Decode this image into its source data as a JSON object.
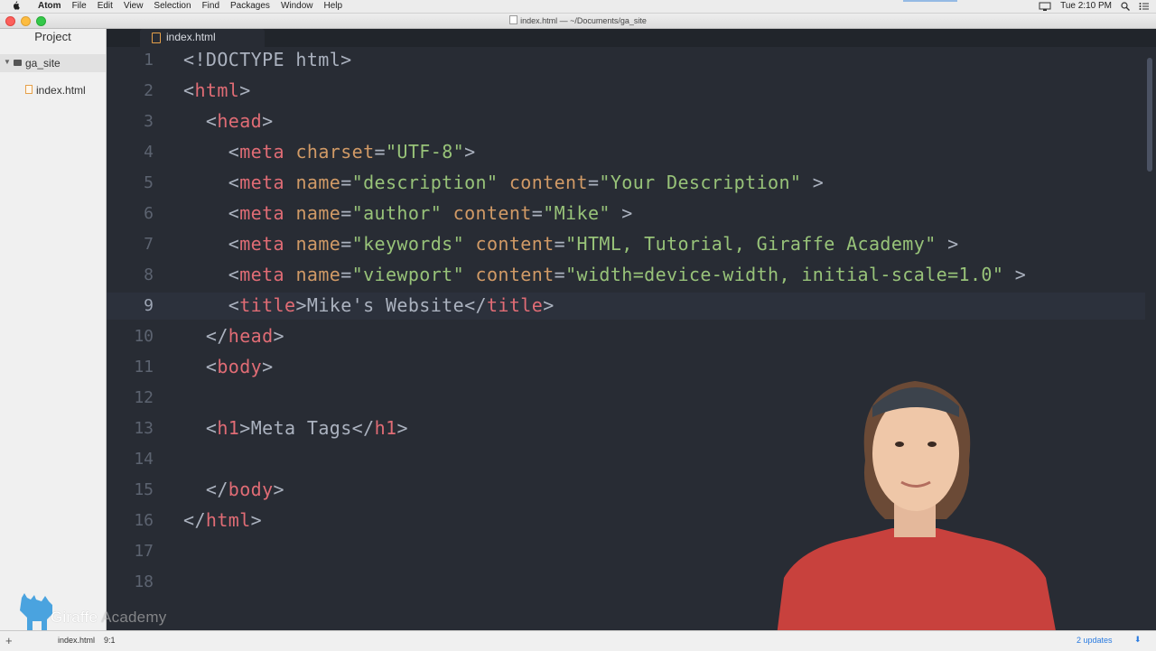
{
  "menubar": {
    "app": "Atom",
    "items": [
      "File",
      "Edit",
      "View",
      "Selection",
      "Find",
      "Packages",
      "Window",
      "Help"
    ],
    "clock": "Tue 2:10 PM"
  },
  "window": {
    "title": "index.html — ~/Documents/ga_site"
  },
  "sidebar": {
    "header": "Project",
    "folder": "ga_site",
    "file": "index.html"
  },
  "tab": {
    "label": "index.html"
  },
  "editor": {
    "lines": [
      {
        "num": "1",
        "active": false
      },
      {
        "num": "2",
        "active": false
      },
      {
        "num": "3",
        "active": false
      },
      {
        "num": "4",
        "active": false
      },
      {
        "num": "5",
        "active": false
      },
      {
        "num": "6",
        "active": false
      },
      {
        "num": "7",
        "active": false
      },
      {
        "num": "8",
        "active": false
      },
      {
        "num": "9",
        "active": true
      },
      {
        "num": "10",
        "active": false
      },
      {
        "num": "11",
        "active": false
      },
      {
        "num": "12",
        "active": false
      },
      {
        "num": "13",
        "active": false
      },
      {
        "num": "14",
        "active": false
      },
      {
        "num": "15",
        "active": false
      },
      {
        "num": "16",
        "active": false
      },
      {
        "num": "17",
        "active": false
      },
      {
        "num": "18",
        "active": false
      }
    ],
    "code": {
      "l1": "<!DOCTYPE html>",
      "l2_tag": "html",
      "l3_tag": "head",
      "l4": {
        "tag": "meta",
        "attr1": "charset",
        "val1": "\"UTF-8\""
      },
      "l5": {
        "tag": "meta",
        "attr1": "name",
        "val1": "\"description\"",
        "attr2": "content",
        "val2": "\"Your Description\""
      },
      "l6": {
        "tag": "meta",
        "attr1": "name",
        "val1": "\"author\"",
        "attr2": "content",
        "val2": "\"Mike\""
      },
      "l7": {
        "tag": "meta",
        "attr1": "name",
        "val1": "\"keywords\"",
        "attr2": "content",
        "val2": "\"HTML, Tutorial, Giraffe Academy\""
      },
      "l8": {
        "tag": "meta",
        "attr1": "name",
        "val1": "\"viewport\"",
        "attr2": "content",
        "val2": "\"width=device-width, initial-scale=1.0\""
      },
      "l9": {
        "tag": "title",
        "text": "Mike's Website"
      },
      "l10_tag": "head",
      "l11_tag": "body",
      "l13": {
        "tag": "h1",
        "text": "Meta Tags"
      },
      "l15_tag": "body",
      "l16_tag": "html"
    }
  },
  "statusbar": {
    "file": "index.html",
    "cursor": "9:1",
    "updates": "2 updates"
  },
  "logo": {
    "name_bold": "Giraffe",
    "name_light": "Academy"
  }
}
